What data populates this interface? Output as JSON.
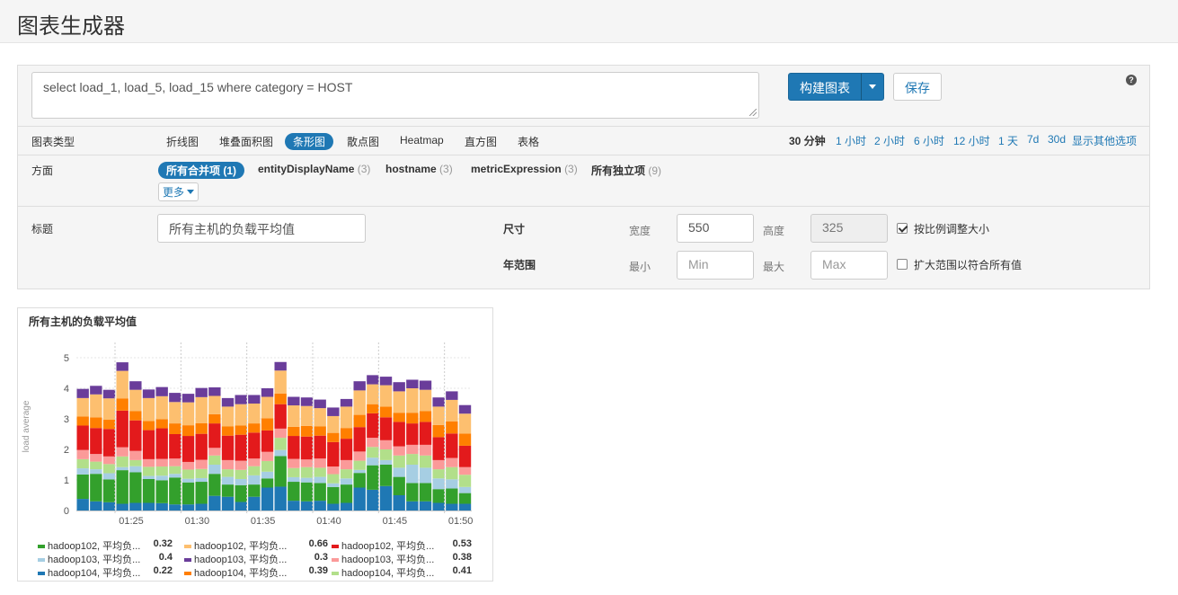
{
  "header": {
    "title": "图表生成器"
  },
  "query": {
    "text": "select load_1, load_5, load_15 where category = HOST"
  },
  "buttons": {
    "build": "构建图表",
    "save": "保存",
    "help": "?"
  },
  "chart_type": {
    "label": "图表类型",
    "items": [
      "折线图",
      "堆叠面积图",
      "条形图",
      "散点图",
      "Heatmap",
      "直方图",
      "表格"
    ],
    "active": "条形图"
  },
  "time_range": {
    "items": [
      "30 分钟",
      "1 小时",
      "2 小时",
      "6 小时",
      "12 小时",
      "1 天",
      "7d",
      "30d",
      "显示其他选项"
    ],
    "active": "30 分钟"
  },
  "facets": {
    "label": "方面",
    "items": [
      {
        "name": "所有合并项",
        "count": "(1)"
      },
      {
        "name": "entityDisplayName",
        "count": "(3)"
      },
      {
        "name": "hostname",
        "count": "(3)"
      },
      {
        "name": "metricExpression",
        "count": "(3)"
      },
      {
        "name": "所有独立项",
        "count": "(9)"
      }
    ],
    "more": "更多"
  },
  "options": {
    "title_label": "标题",
    "title_value": "所有主机的负载平均值",
    "size_label": "尺寸",
    "width_label": "宽度",
    "width_value": "550",
    "height_label": "高度",
    "height_value": "325",
    "scale_label": "按比例调整大小",
    "scale_checked": true,
    "y_range_label": "年范围",
    "min_label": "最小",
    "min_placeholder": "Min",
    "max_label": "最大",
    "max_placeholder": "Max",
    "expand_label": "扩大范围以符合所有值",
    "expand_checked": false
  },
  "chart_data": {
    "type": "bar",
    "stacked": true,
    "title": "所有主机的负载平均值",
    "ylabel": "load average",
    "ylim": [
      0,
      5.5
    ],
    "yticks": [
      0,
      1,
      2,
      3,
      4,
      5
    ],
    "xtick_labels": [
      "01:25",
      "01:30",
      "01:35",
      "01:40",
      "01:45",
      "01:50"
    ],
    "xtick_bar_index": [
      3,
      8,
      13,
      18,
      23,
      28
    ],
    "bar_count": 30,
    "series": [
      {
        "name": "hadoop104, 平均负...",
        "color": "#1f78b4",
        "values": [
          0.38,
          0.3,
          0.27,
          0.22,
          0.25,
          0.25,
          0.24,
          0.2,
          0.2,
          0.22,
          0.48,
          0.45,
          0.28,
          0.45,
          0.75,
          0.78,
          0.32,
          0.3,
          0.32,
          0.22,
          0.25,
          0.75,
          0.68,
          0.8,
          0.5,
          0.3,
          0.3,
          0.25,
          0.22,
          0.22
        ]
      },
      {
        "name": "hadoop102, 平均负...",
        "color": "#33a02c",
        "values": [
          0.8,
          0.9,
          0.75,
          1.1,
          1.0,
          0.78,
          0.75,
          0.88,
          0.72,
          0.72,
          0.72,
          0.4,
          0.55,
          0.4,
          0.3,
          1.0,
          0.62,
          0.62,
          0.58,
          0.55,
          0.6,
          0.48,
          0.8,
          0.7,
          0.6,
          0.6,
          0.6,
          0.45,
          0.5,
          0.35
        ]
      },
      {
        "name": "hadoop103, 平均负...",
        "color": "#a6cee3",
        "values": [
          0.2,
          0.15,
          0.2,
          0.1,
          0.2,
          0.1,
          0.15,
          0.12,
          0.12,
          0.12,
          0.3,
          0.25,
          0.2,
          0.3,
          0.22,
          0.2,
          0.15,
          0.15,
          0.2,
          0.12,
          0.2,
          0.1,
          0.25,
          0.15,
          0.3,
          0.6,
          0.5,
          0.35,
          0.3,
          0.2
        ]
      },
      {
        "name": "hadoop104, 平均负...",
        "color": "#b2df8a",
        "values": [
          0.3,
          0.25,
          0.3,
          0.35,
          0.2,
          0.3,
          0.3,
          0.25,
          0.3,
          0.3,
          0.3,
          0.25,
          0.3,
          0.3,
          0.35,
          0.4,
          0.3,
          0.35,
          0.3,
          0.3,
          0.3,
          0.3,
          0.35,
          0.35,
          0.4,
          0.35,
          0.4,
          0.3,
          0.4,
          0.4
        ]
      },
      {
        "name": "hadoop103, 平均负...",
        "color": "#fb9a99",
        "values": [
          0.3,
          0.25,
          0.25,
          0.3,
          0.3,
          0.25,
          0.25,
          0.25,
          0.25,
          0.3,
          0.25,
          0.3,
          0.3,
          0.25,
          0.3,
          0.3,
          0.3,
          0.25,
          0.3,
          0.25,
          0.3,
          0.3,
          0.3,
          0.3,
          0.3,
          0.3,
          0.35,
          0.3,
          0.3,
          0.25
        ]
      },
      {
        "name": "hadoop102, 平均负...",
        "color": "#e31a1c",
        "values": [
          0.8,
          0.85,
          0.9,
          1.2,
          1.0,
          0.95,
          1.0,
          0.8,
          0.85,
          0.85,
          0.8,
          0.8,
          0.85,
          0.85,
          0.7,
          0.8,
          0.75,
          0.75,
          0.75,
          0.8,
          0.7,
          0.8,
          0.8,
          0.75,
          0.8,
          0.7,
          0.75,
          0.75,
          0.8,
          0.7
        ]
      },
      {
        "name": "hadoop104, 平均负...",
        "color": "#ff7f00",
        "values": [
          0.3,
          0.35,
          0.3,
          0.4,
          0.3,
          0.3,
          0.3,
          0.35,
          0.35,
          0.35,
          0.3,
          0.3,
          0.3,
          0.3,
          0.4,
          0.35,
          0.3,
          0.35,
          0.3,
          0.3,
          0.35,
          0.4,
          0.3,
          0.35,
          0.3,
          0.35,
          0.35,
          0.4,
          0.4,
          0.4
        ]
      },
      {
        "name": "hadoop102, 平均负...",
        "color": "#fdbf6f",
        "values": [
          0.6,
          0.75,
          0.7,
          0.9,
          0.7,
          0.75,
          0.75,
          0.7,
          0.75,
          0.85,
          0.6,
          0.65,
          0.7,
          0.65,
          0.7,
          0.75,
          0.7,
          0.65,
          0.6,
          0.55,
          0.7,
          0.8,
          0.65,
          0.7,
          0.7,
          0.8,
          0.7,
          0.6,
          0.7,
          0.65
        ]
      },
      {
        "name": "hadoop103, 平均负...",
        "color": "#6a3d9a",
        "values": [
          0.3,
          0.28,
          0.28,
          0.28,
          0.28,
          0.28,
          0.3,
          0.3,
          0.28,
          0.3,
          0.28,
          0.28,
          0.3,
          0.28,
          0.28,
          0.28,
          0.28,
          0.28,
          0.28,
          0.28,
          0.25,
          0.3,
          0.3,
          0.28,
          0.3,
          0.28,
          0.3,
          0.3,
          0.28,
          0.28
        ]
      }
    ],
    "legend": [
      {
        "name": "hadoop102, 平均负...",
        "value": "0.32",
        "color": "#33a02c"
      },
      {
        "name": "hadoop102, 平均负...",
        "value": "0.66",
        "color": "#fdbf6f"
      },
      {
        "name": "hadoop102, 平均负...",
        "value": "0.53",
        "color": "#e31a1c"
      },
      {
        "name": "hadoop103, 平均负...",
        "value": "0.4",
        "color": "#a6cee3"
      },
      {
        "name": "hadoop103, 平均负...",
        "value": "0.3",
        "color": "#6a3d9a"
      },
      {
        "name": "hadoop103, 平均负...",
        "value": "0.38",
        "color": "#fb9a99"
      },
      {
        "name": "hadoop104, 平均负...",
        "value": "0.22",
        "color": "#1f78b4"
      },
      {
        "name": "hadoop104, 平均负...",
        "value": "0.39",
        "color": "#ff7f00"
      },
      {
        "name": "hadoop104, 平均负...",
        "value": "0.41",
        "color": "#b2df8a"
      }
    ]
  }
}
